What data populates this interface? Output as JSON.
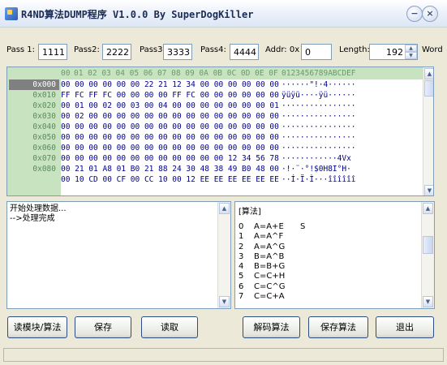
{
  "window": {
    "title": "R4ND算法DUMP程序 V1.0.0 By SuperDogKiller",
    "controls": [
      "−",
      "×"
    ]
  },
  "params": {
    "pass1_label": "Pass 1:",
    "pass1_value": "1111",
    "pass2_label": "Pass2:",
    "pass2_value": "2222",
    "pass3_label": "Pass3:",
    "pass3_value": "3333",
    "pass4_label": "Pass4:",
    "pass4_value": "4444",
    "addr_label": "Addr: 0x",
    "addr_value": "0",
    "length_label": "Length:",
    "length_value": "192",
    "word_label": "Word"
  },
  "hex_view": {
    "header_blank": "00",
    "header_cols": "01 02 03 04 05 06 07 08 09 0A 0B 0C 0D 0E 0F",
    "ascii_header": "0123456789ABCDEF",
    "rows": [
      {
        "addr": "0x000",
        "bytes": "00 00 00 00 00 00 22 21 12 34 00 00 00 00 00 00",
        "ascii": "······\"!·4······"
      },
      {
        "addr": "0x010",
        "bytes": "FF FC FF FC 00 00 00 00 FF FC 00 00 00 00 00 00",
        "ascii": "ÿüÿü····ÿü······"
      },
      {
        "addr": "0x020",
        "bytes": "00 01 00 02 00 03 00 04 00 00 00 00 00 00 00 01",
        "ascii": "················"
      },
      {
        "addr": "0x030",
        "bytes": "00 02 00 00 00 00 00 00 00 00 00 00 00 00 00 00",
        "ascii": "················"
      },
      {
        "addr": "0x040",
        "bytes": "00 00 00 00 00 00 00 00 00 00 00 00 00 00 00 00",
        "ascii": "················"
      },
      {
        "addr": "0x050",
        "bytes": "00 00 00 00 00 00 00 00 00 00 00 00 00 00 00 00",
        "ascii": "················"
      },
      {
        "addr": "0x060",
        "bytes": "00 00 00 00 00 00 00 00 00 00 00 00 00 00 00 00",
        "ascii": "················"
      },
      {
        "addr": "0x070",
        "bytes": "00 00 00 00 00 00 00 00 00 00 00 00 12 34 56 78",
        "ascii": "············4Vx"
      },
      {
        "addr": "0x080",
        "bytes": "00 21 01 A8 01 B0 21 88 24 30 48 38 49 B0 48 00",
        "ascii": "·!·¨·°!$0H8I°H·"
      },
      {
        "addr": "",
        "bytes": "00 10 CD 00 CF 00 CC 10 00 12 EE EE EE EE EE EE",
        "ascii": "··Í·Ï·Ì···îîîîîî"
      }
    ]
  },
  "log": {
    "lines": [
      "开始处理数据...",
      "-->处理完成"
    ]
  },
  "algo": {
    "header": "[算法]",
    "rows": [
      {
        "n": "0",
        "expr": "A=A+E",
        "extra": "S"
      },
      {
        "n": "1",
        "expr": "A=A^F",
        "extra": ""
      },
      {
        "n": "2",
        "expr": "A=A^G",
        "extra": ""
      },
      {
        "n": "3",
        "expr": "B=A^B",
        "extra": ""
      },
      {
        "n": "4",
        "expr": "B=B+G",
        "extra": ""
      },
      {
        "n": "5",
        "expr": "C=C+H",
        "extra": ""
      },
      {
        "n": "6",
        "expr": "C=C^G",
        "extra": ""
      },
      {
        "n": "7",
        "expr": "C=C+A",
        "extra": ""
      }
    ]
  },
  "buttons": {
    "read_module": "读模块/算法",
    "save": "保存",
    "read": "读取",
    "decode": "解码算法",
    "save_algo": "保存算法",
    "exit": "退出"
  },
  "colors": {
    "hex_highlight": "#c8e3c0",
    "bytes_color": "#00008b",
    "addr_color": "#5a8a5a",
    "selected_addr_bg": "#808080",
    "header_color": "#6a9a6a"
  }
}
